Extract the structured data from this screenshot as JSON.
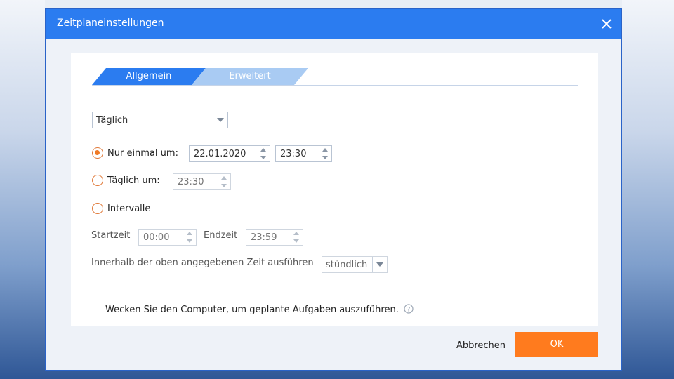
{
  "dialog": {
    "title": "Zeitplaneinstellungen",
    "accent_color": "#2b7cf0",
    "ok_color": "#ff7b1e",
    "close_icon": "close-icon"
  },
  "tabs": [
    {
      "label": "Allgemein",
      "active": true
    },
    {
      "label": "Erweitert",
      "active": false
    }
  ],
  "frequency": {
    "selected": "Täglich"
  },
  "options": {
    "once": {
      "label": "Nur einmal um:",
      "checked": true,
      "date": "22.01.2020",
      "time": "23:30"
    },
    "daily": {
      "label": "Täglich um:",
      "checked": false,
      "time": "23:30"
    },
    "interval": {
      "label": "Intervalle",
      "checked": false
    }
  },
  "interval": {
    "start_label": "Startzeit",
    "start_value": "00:00",
    "end_label": "Endzeit",
    "end_value": "23:59",
    "run_label": "Innerhalb der oben angegebenen Zeit ausführen",
    "run_selected": "stündlich"
  },
  "wake": {
    "label": "Wecken Sie den Computer, um geplante Aufgaben auszuführen.",
    "checked": false
  },
  "buttons": {
    "cancel": "Abbrechen",
    "ok": "OK"
  }
}
